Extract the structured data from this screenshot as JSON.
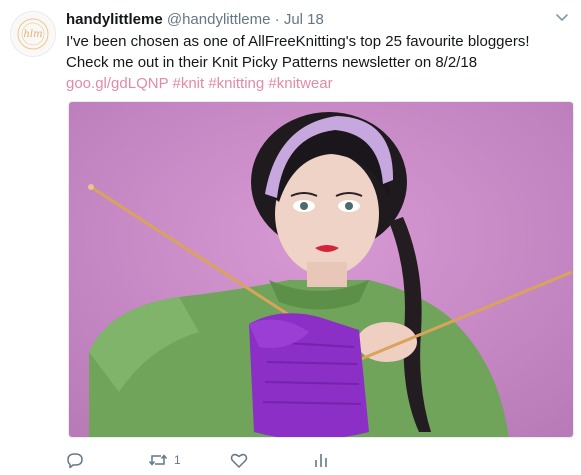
{
  "tweet": {
    "author_name": "handylittleme",
    "author_handle": "@handylittleme",
    "separator": "·",
    "date": "Jul 18",
    "text_part1": "I've been chosen as one of AllFreeKnitting's top 25 favourite bloggers! Check me out in their Knit Picky Patterns newsletter on 8/2/18 ",
    "link": "goo.gl/gdLQNP",
    "hashtags": [
      "#knit",
      "#knitting",
      "#knitwear"
    ]
  },
  "actions": {
    "reply_count": "",
    "retweet_count": "1",
    "like_count": ""
  },
  "icons": [
    "reply-icon",
    "retweet-icon",
    "like-icon",
    "analytics-icon",
    "chevron-down-icon"
  ],
  "colors": {
    "link": "#e58aa6",
    "text": "#14171a",
    "secondary": "#657786",
    "photo_background": "#c98cc7"
  }
}
